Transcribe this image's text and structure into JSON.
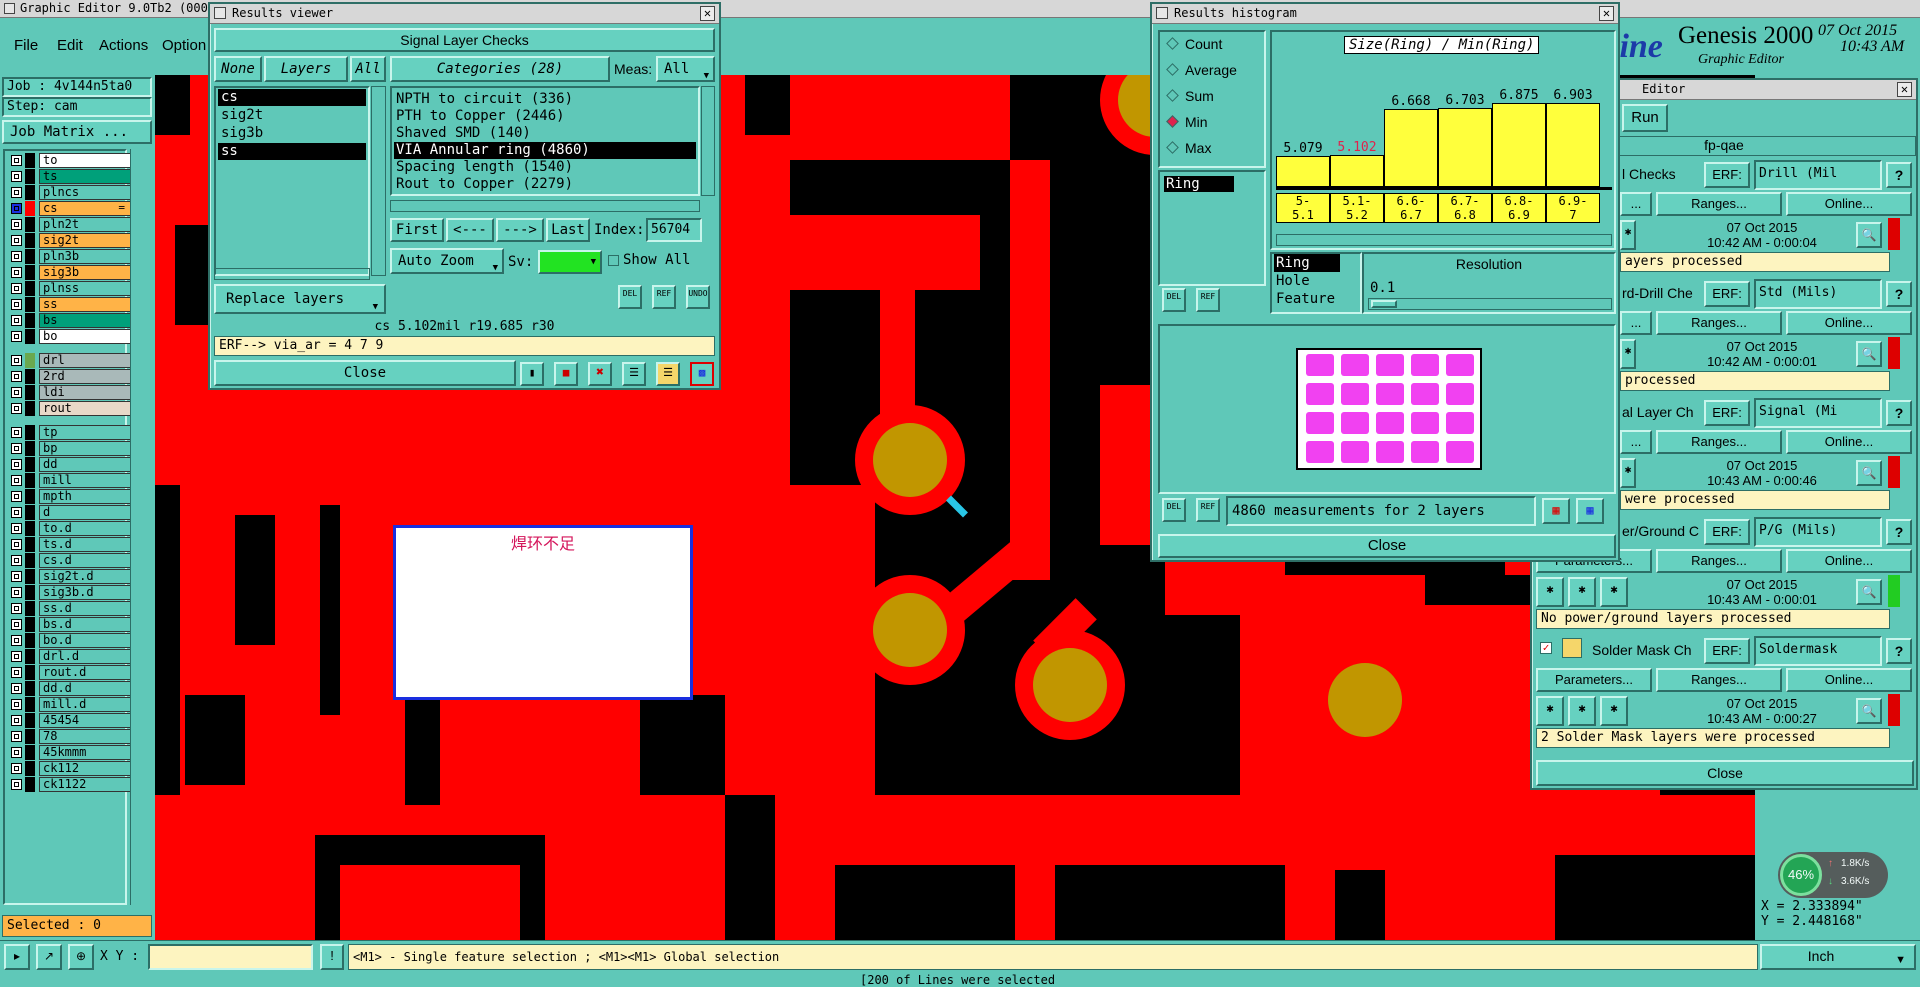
{
  "main_window": {
    "title": "Graphic Editor 9.0Tb2 (000)",
    "menu": [
      "File",
      "Edit",
      "Actions",
      "Option"
    ],
    "brand": "Genesis 2000",
    "brand_sub": "Graphic Editor",
    "brand_logo": "line",
    "date": "07 Oct 2015",
    "time": "10:43 AM"
  },
  "left_panel": {
    "job": "Job : 4v144n5ta0",
    "step": "Step: cam",
    "job_matrix": "Job Matrix ...",
    "selected": "Selected : 0",
    "layers": [
      {
        "name": "to",
        "bg": "#ffffff",
        "swatch": "#000000"
      },
      {
        "name": "ts",
        "bg": "#00a07a",
        "swatch": "#000000"
      },
      {
        "name": "plncs",
        "bg": "#5fc8b8",
        "swatch": "#000000"
      },
      {
        "name": "cs",
        "bg": "#ffb347",
        "swatch": "#ff0000",
        "active": true
      },
      {
        "name": "pln2t",
        "bg": "#5fc8b8",
        "swatch": "#000000"
      },
      {
        "name": "sig2t",
        "bg": "#ffb347",
        "swatch": "#000000"
      },
      {
        "name": "pln3b",
        "bg": "#5fc8b8",
        "swatch": "#000000"
      },
      {
        "name": "sig3b",
        "bg": "#ffb347",
        "swatch": "#000000"
      },
      {
        "name": "plnss",
        "bg": "#5fc8b8",
        "swatch": "#000000"
      },
      {
        "name": "ss",
        "bg": "#ffb347",
        "swatch": "#000000"
      },
      {
        "name": "bs",
        "bg": "#00a07a",
        "swatch": "#000000"
      },
      {
        "name": "bo",
        "bg": "#ffffff",
        "swatch": "#000000"
      },
      {
        "name": "drl",
        "bg": "#a9b9b9",
        "swatch": "#6aa84f"
      },
      {
        "name": "2rd",
        "bg": "#a9b9b9",
        "swatch": "#000000"
      },
      {
        "name": "ldi",
        "bg": "#a9b9b9",
        "swatch": "#000000"
      },
      {
        "name": "rout",
        "bg": "#e8d8c8",
        "swatch": "#000000"
      },
      {
        "name": "tp",
        "bg": "#5fc8b8",
        "swatch": "#000000"
      },
      {
        "name": "bp",
        "bg": "#5fc8b8",
        "swatch": "#000000"
      },
      {
        "name": "dd",
        "bg": "#5fc8b8",
        "swatch": "#000000"
      },
      {
        "name": "mill",
        "bg": "#5fc8b8",
        "swatch": "#000000"
      },
      {
        "name": "mpth",
        "bg": "#5fc8b8",
        "swatch": "#000000"
      },
      {
        "name": "d",
        "bg": "#5fc8b8",
        "swatch": "#000000"
      },
      {
        "name": "to.d",
        "bg": "#5fc8b8",
        "swatch": "#000000"
      },
      {
        "name": "ts.d",
        "bg": "#5fc8b8",
        "swatch": "#000000"
      },
      {
        "name": "cs.d",
        "bg": "#5fc8b8",
        "swatch": "#000000"
      },
      {
        "name": "sig2t.d",
        "bg": "#5fc8b8",
        "swatch": "#000000"
      },
      {
        "name": "sig3b.d",
        "bg": "#5fc8b8",
        "swatch": "#000000"
      },
      {
        "name": "ss.d",
        "bg": "#5fc8b8",
        "swatch": "#000000"
      },
      {
        "name": "bs.d",
        "bg": "#5fc8b8",
        "swatch": "#000000"
      },
      {
        "name": "bo.d",
        "bg": "#5fc8b8",
        "swatch": "#000000"
      },
      {
        "name": "drl.d",
        "bg": "#5fc8b8",
        "swatch": "#000000"
      },
      {
        "name": "rout.d",
        "bg": "#5fc8b8",
        "swatch": "#000000"
      },
      {
        "name": "dd.d",
        "bg": "#5fc8b8",
        "swatch": "#000000"
      },
      {
        "name": "mill.d",
        "bg": "#5fc8b8",
        "swatch": "#000000"
      },
      {
        "name": "45454",
        "bg": "#5fc8b8",
        "swatch": "#000000"
      },
      {
        "name": "78",
        "bg": "#5fc8b8",
        "swatch": "#000000"
      },
      {
        "name": "45kmmm",
        "bg": "#5fc8b8",
        "swatch": "#000000"
      },
      {
        "name": "ck112",
        "bg": "#5fc8b8",
        "swatch": "#000000"
      },
      {
        "name": "ck1122",
        "bg": "#5fc8b8",
        "swatch": "#000000"
      }
    ]
  },
  "canvas": {
    "note_text": "焊环不足",
    "colors": {
      "copper": "#ff0000",
      "pad": "#c19600",
      "background": "#000000"
    }
  },
  "bottom_bar": {
    "xy_label": "X Y :",
    "hint": "<M1> - Single feature selection ; <M1><M1> Global selection",
    "units": "Inch",
    "coord_x": "X = 2.333894\"",
    "coord_y": "Y = 2.448168\"",
    "status_line": "[200 of Lines were selected",
    "net_percent": "46%",
    "net_up": "1.8K/s",
    "net_down": "3.6K/s"
  },
  "results_viewer": {
    "title": "Results viewer",
    "header": "Signal Layer Checks",
    "none_btn": "None",
    "layers_btn": "Layers",
    "all_btn": "All",
    "layers": [
      "cs",
      "sig2t",
      "sig3b",
      "ss"
    ],
    "categories_label": "Categories (28)",
    "meas_label": "Meas:",
    "meas_value": "All",
    "categories": [
      "NPTH to circuit (336)",
      "PTH to Copper (2446)",
      "Shaved SMD (140)",
      "VIA Annular ring (4860)",
      "Spacing length (1540)",
      "Rout to Copper (2279)"
    ],
    "selected_category": 3,
    "first_btn": "First",
    "prev_btn": "<---",
    "next_btn": "--->",
    "last_btn": "Last",
    "index_label": "Index:",
    "index_value": "56704",
    "auto_zoom": "Auto Zoom",
    "sv_label": "Sv:",
    "show_all": "Show All",
    "replace_layers": "Replace layers",
    "info": "cs 5.102mil  r19.685  r30",
    "erf_line": "ERF--> via_ar = 4 7 9",
    "close": "Close",
    "icon_del": "DEL",
    "icon_ref": "REF",
    "icon_undo": "UNDO"
  },
  "histogram": {
    "title": "Results histogram",
    "radio_options": [
      "Count",
      "Average",
      "Sum",
      "Min",
      "Max"
    ],
    "selected_radio": "Min",
    "chart_title": "Size(Ring) / Min(Ring)",
    "list_items": [
      "Ring"
    ],
    "type_items": [
      "Ring",
      "Hole",
      "Feature"
    ],
    "resolution_label": "Resolution",
    "resolution_value": "0.1",
    "measurements": "4860 measurements for 2 layers",
    "close": "Close",
    "chart_data": {
      "type": "bar",
      "title": "Size(Ring) / Min(Ring)",
      "categories": [
        "5-5.1",
        "5.1-5.2",
        "6.6-6.7",
        "6.7-6.8",
        "6.8-6.9",
        "6.9-7"
      ],
      "tick_top": [
        "5-",
        "5.1-",
        "6.6-",
        "6.7-",
        "6.8-",
        "6.9-"
      ],
      "tick_bottom": [
        "5.1",
        "5.2",
        "6.7",
        "6.8",
        "6.9",
        "7"
      ],
      "values": [
        5.079,
        5.102,
        6.668,
        6.703,
        6.875,
        6.903
      ],
      "labels": [
        "5.079",
        "5.102",
        "6.668",
        "6.703",
        "6.875",
        "6.903"
      ],
      "highlight_index": 1,
      "highlight_color": "#e0224d",
      "bar_color": "#ffff3c",
      "ylim": [
        4.0,
        7.3
      ],
      "grid": false
    }
  },
  "checklist": {
    "title": "Editor",
    "run": "Run",
    "name": "fp-qae",
    "close": "Close",
    "sections": [
      {
        "label": "l Checks",
        "erf_label": "ERF:",
        "erf": "Drill (Mil",
        "ranges": "Ranges...",
        "online": "Online...",
        "date": "07 Oct 2015",
        "time": "10:42 AM - 0:00:04",
        "status": "ayers processed"
      },
      {
        "label": "rd-Drill Che",
        "erf_label": "ERF:",
        "erf": "Std (Mils)",
        "ranges": "Ranges...",
        "online": "Online...",
        "date": "07 Oct 2015",
        "time": "10:42 AM - 0:00:01",
        "status": "processed"
      },
      {
        "label": "al Layer Ch",
        "erf_label": "ERF:",
        "erf": "Signal (Mi",
        "ranges": "Ranges...",
        "online": "Online...",
        "date": "07 Oct 2015",
        "time": "10:43 AM - 0:00:46",
        "status": "were processed"
      },
      {
        "label": "er/Ground C",
        "erf_label": "ERF:",
        "erf": "P/G (Mils)",
        "params": "Parameters...",
        "ranges": "Ranges...",
        "online": "Online...",
        "date": "07 Oct 2015",
        "time": "10:43 AM - 0:00:01",
        "status": "No power/ground layers processed"
      },
      {
        "label": "Solder Mask Ch",
        "erf_label": "ERF:",
        "erf": "Soldermask",
        "params": "Parameters...",
        "ranges": "Ranges...",
        "online": "Online...",
        "date": "07 Oct 2015",
        "time": "10:43 AM - 0:00:27",
        "status": "2 Solder Mask layers were processed"
      }
    ]
  }
}
